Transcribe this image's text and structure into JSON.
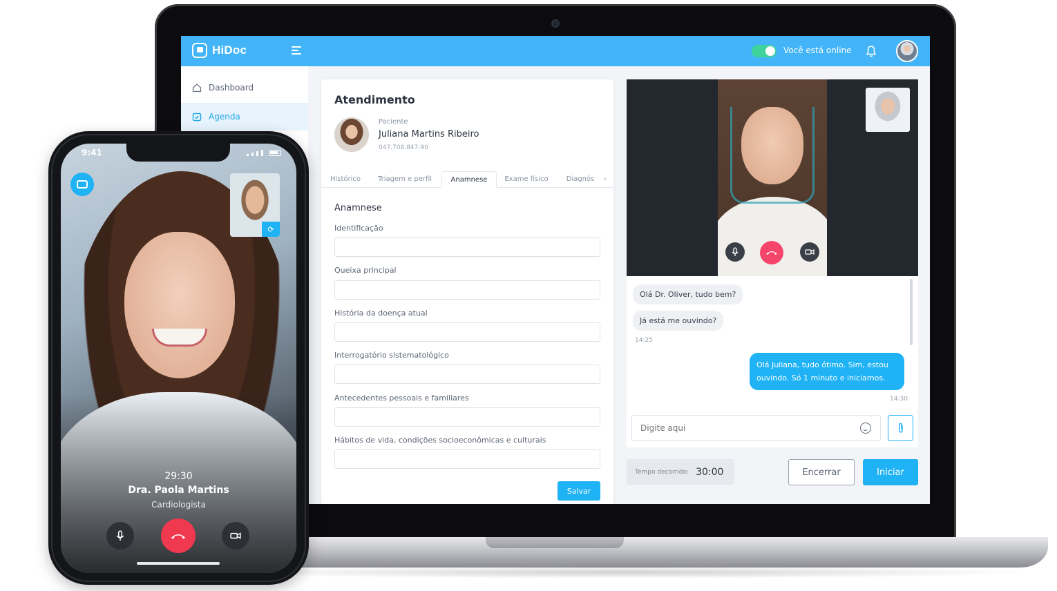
{
  "app": {
    "name": "HiDoc"
  },
  "topbar": {
    "online_status": "Você está online"
  },
  "sidebar": {
    "items": [
      {
        "label": "Dashboard"
      },
      {
        "label": "Agenda"
      }
    ]
  },
  "attendance": {
    "title": "Atendimento",
    "patient_label": "Paciente",
    "patient_name": "Juliana Martins Ribeiro",
    "patient_doc": "047.708.847-90",
    "tabs": [
      {
        "label": "Histórico"
      },
      {
        "label": "Triagem e perfil"
      },
      {
        "label": "Anamnese",
        "active": true
      },
      {
        "label": "Exame físico"
      },
      {
        "label": "Diagnós"
      }
    ],
    "section_title": "Anamnese",
    "fields": [
      {
        "label": "Identificação"
      },
      {
        "label": "Queixa principal"
      },
      {
        "label": "História da doença atual"
      },
      {
        "label": "Interrogatório sistematológico"
      },
      {
        "label": "Antecedentes pessoais e familiares"
      },
      {
        "label": "Hábitos de vida, condições socioeconômicas e culturais"
      }
    ],
    "save_label": "Salvar"
  },
  "chat": {
    "messages": [
      {
        "text": "Olá Dr. Oliver, tudo bem?",
        "direction": "in"
      },
      {
        "text": "Já está me ouvindo?",
        "direction": "in",
        "time": "14:25"
      },
      {
        "text": "Olá Juliana, tudo ótimo. Sim, estou ouvindo. Só 1 minuto e iniciamos.",
        "direction": "out",
        "time": "14:30"
      }
    ],
    "input_placeholder": "Digite aqui"
  },
  "session": {
    "elapsed_label": "Tempo decorrido:",
    "elapsed_value": "30:00",
    "end_label": "Encerrar",
    "start_label": "Iniciar"
  },
  "phone": {
    "status_time": "9:41",
    "call_timer": "29:30",
    "doctor_name": "Dra. Paola Martins",
    "doctor_role": "Cardiologista"
  },
  "colors": {
    "accent": "#1fb2f4",
    "topbar": "#42b4f7",
    "hangup": "#f0384f",
    "online": "#3ed39a"
  },
  "icons": [
    "menu-icon",
    "bell-icon",
    "home-icon",
    "calendar-icon",
    "mic-icon",
    "hangup-icon",
    "camera-icon",
    "emoji-icon",
    "paperclip-icon",
    "chat-icon",
    "switch-camera-icon",
    "chevron-right-icon"
  ]
}
